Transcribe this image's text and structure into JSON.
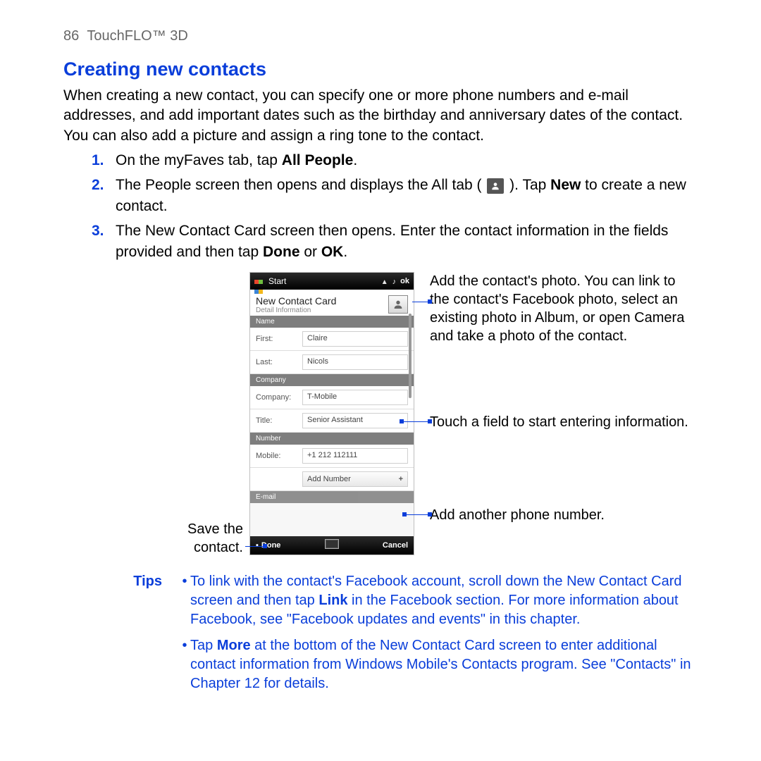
{
  "header": {
    "page_no": "86",
    "section": "TouchFLO™ 3D"
  },
  "title": "Creating new contacts",
  "intro": "When creating a new contact, you can specify one or more phone numbers and e-mail addresses, and add important dates such as the birthday and anniversary dates of the contact. You can also add a picture and assign a ring tone to the contact.",
  "steps": {
    "s1_a": "On the myFaves tab, tap ",
    "s1_b": "All People",
    "s1_c": ".",
    "s2_a": "The People screen then opens and displays the All tab ( ",
    "s2_b": " ). Tap ",
    "s2_c": "New",
    "s2_d": " to create a new contact.",
    "s3_a": "The New Contact Card screen then opens. Enter the contact information in the fields provided and then tap ",
    "s3_b": "Done",
    "s3_c": " or ",
    "s3_d": "OK",
    "s3_e": "."
  },
  "phone": {
    "start": "Start",
    "ok": "ok",
    "card_title": "New Contact Card",
    "card_sub": "Detail Information",
    "sec_name": "Name",
    "first_lab": "First:",
    "first_val": "Claire",
    "last_lab": "Last:",
    "last_val": "Nicols",
    "sec_company": "Company",
    "company_lab": "Company:",
    "company_val": "T-Mobile",
    "title_lab": "Title:",
    "title_val": "Senior Assistant",
    "sec_number": "Number",
    "mobile_lab": "Mobile:",
    "mobile_val": "+1 212 112111",
    "add_number": "Add Number",
    "sec_email": "E-mail",
    "done": "Done",
    "cancel": "Cancel"
  },
  "callouts": {
    "photo": "Add the contact's photo. You can link to the contact's Facebook photo, select an existing photo in Album, or open Camera and take a photo of the contact.",
    "field": "Touch a field to start entering information.",
    "add_number": "Add another phone number.",
    "save_a": "Save the",
    "save_b": "contact."
  },
  "tips": {
    "label": "Tips",
    "t1_a": "To link with the contact's Facebook account, scroll down the New Contact Card screen and then tap ",
    "t1_b": "Link",
    "t1_c": " in the Facebook section. For more information about Facebook, see \"Facebook updates and events\" in this chapter.",
    "t2_a": "Tap ",
    "t2_b": "More",
    "t2_c": " at the bottom of the New Contact Card screen to enter additional contact information from Windows Mobile's Contacts program. See \"Contacts\" in Chapter 12 for details."
  }
}
